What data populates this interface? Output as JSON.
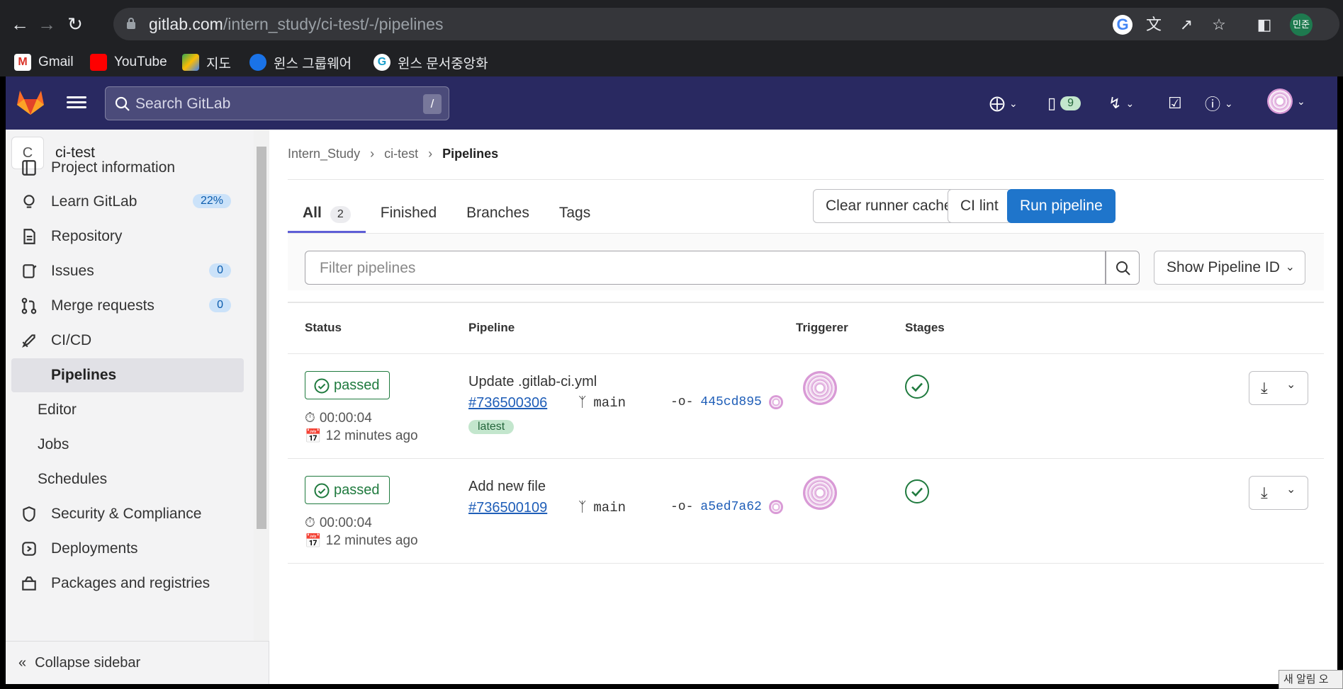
{
  "browser": {
    "url_host": "gitlab.com",
    "url_path": "/intern_study/ci-test/-/pipelines",
    "profile": "민준",
    "bookmarks": [
      "Gmail",
      "YouTube",
      "지도",
      "윈스 그룹웨어",
      "윈스 문서중앙화"
    ]
  },
  "topnav": {
    "search_placeholder": "Search GitLab",
    "search_shortcut": "/",
    "issues_count": "9"
  },
  "sidebar": {
    "project_initial": "C",
    "project_name": "ci-test",
    "items": [
      {
        "label": "Project information",
        "icon": "book-icon"
      },
      {
        "label": "Learn GitLab",
        "icon": "bulb-icon",
        "count": "22%"
      },
      {
        "label": "Repository",
        "icon": "doc-icon"
      },
      {
        "label": "Issues",
        "icon": "issues-icon",
        "count": "0"
      },
      {
        "label": "Merge requests",
        "icon": "merge-request-icon",
        "count": "0"
      },
      {
        "label": "CI/CD",
        "icon": "rocket-icon"
      },
      {
        "label": "Pipelines"
      },
      {
        "label": "Editor"
      },
      {
        "label": "Jobs"
      },
      {
        "label": "Schedules"
      },
      {
        "label": "Security & Compliance",
        "icon": "shield-icon"
      },
      {
        "label": "Deployments",
        "icon": "deploy-icon"
      },
      {
        "label": "Packages and registries",
        "icon": "package-icon"
      }
    ],
    "collapse_label": "Collapse sidebar"
  },
  "breadcrumb": [
    "Intern_Study",
    "ci-test",
    "Pipelines"
  ],
  "tabs": [
    {
      "label": "All",
      "count": "2"
    },
    {
      "label": "Finished"
    },
    {
      "label": "Branches"
    },
    {
      "label": "Tags"
    }
  ],
  "actions": {
    "clear_caches": "Clear runner caches",
    "ci_lint": "CI lint",
    "run_pipeline": "Run pipeline"
  },
  "filter": {
    "placeholder": "Filter pipelines",
    "show_id": "Show Pipeline ID"
  },
  "table": {
    "headers": [
      "Status",
      "Pipeline",
      "Triggerer",
      "Stages"
    ],
    "rows": [
      {
        "status": "passed",
        "duration": "00:00:04",
        "finished": "12 minutes ago",
        "title": "Update .gitlab-ci.yml",
        "id": "#736500306",
        "branch": "main",
        "sha": "445cd895",
        "tag": "latest"
      },
      {
        "status": "passed",
        "duration": "00:00:04",
        "finished": "12 minutes ago",
        "title": "Add new file",
        "id": "#736500109",
        "branch": "main",
        "sha": "a5ed7a62"
      }
    ]
  },
  "colors": {
    "gitlab_nav": "#292961",
    "success": "#1f7a3e",
    "primary": "#1f75cb"
  },
  "notification_text": "새 알림 오"
}
